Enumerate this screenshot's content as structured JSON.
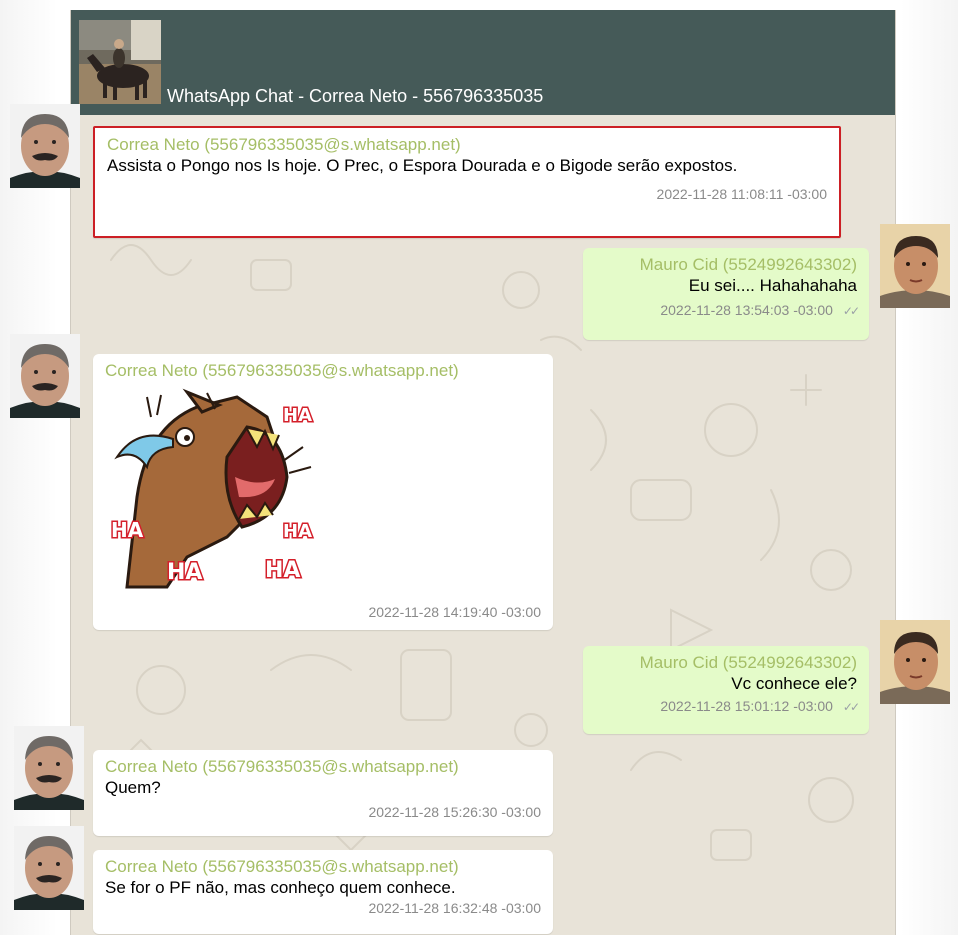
{
  "chat": {
    "title": "WhatsApp Chat - Correa Neto - 556796335035"
  },
  "messages": [
    {
      "sender": "Correa Neto (556796335035@s.whatsapp.net)",
      "text": "Assista o Pongo nos Is hoje. O Prec, o Espora Dourada e o Bigode serão expostos.",
      "timestamp": "2022-11-28 11:08:11 -03:00",
      "direction": "incoming",
      "highlighted": true
    },
    {
      "sender": "Mauro Cid (5524992643302)",
      "text": "Eu sei.... Hahahahaha",
      "timestamp": "2022-11-28 13:54:03 -03:00",
      "direction": "outgoing",
      "ticks": "✓✓"
    },
    {
      "sender": "Correa Neto (556796335035@s.whatsapp.net)",
      "sticker": [
        "HA",
        "HA",
        "HA",
        "HA",
        "HA"
      ],
      "timestamp": "2022-11-28 14:19:40 -03:00",
      "direction": "incoming"
    },
    {
      "sender": "Mauro Cid (5524992643302)",
      "text": "Vc conhece ele?",
      "timestamp": "2022-11-28 15:01:12 -03:00",
      "direction": "outgoing",
      "ticks": "✓✓"
    },
    {
      "sender": "Correa Neto (556796335035@s.whatsapp.net)",
      "text": "Quem?",
      "timestamp": "2022-11-28 15:26:30 -03:00",
      "direction": "incoming"
    },
    {
      "sender": "Correa Neto (556796335035@s.whatsapp.net)",
      "text": "Se for o PF não, mas conheço quem conhece.",
      "timestamp": "2022-11-28 16:32:48 -03:00",
      "direction": "incoming"
    }
  ],
  "colors": {
    "header": "#455a58",
    "background": "#e8e3d8",
    "incoming_bubble": "#ffffff",
    "outgoing_bubble": "#e4fbc9",
    "sender_name": "#a5be66",
    "highlight_border": "#cc1f25"
  }
}
